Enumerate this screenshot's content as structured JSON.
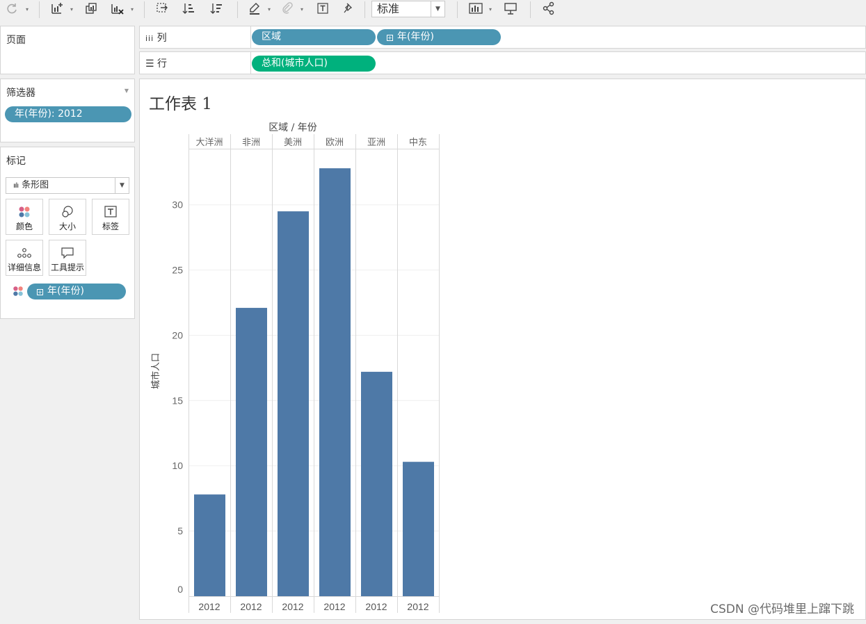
{
  "toolbar": {
    "icons": [
      "refresh-icon",
      "new-worksheet-icon",
      "duplicate-sheet-icon",
      "clear-sheet-icon",
      "swap-icon",
      "sort-ascending-icon",
      "sort-descending-icon",
      "highlight-icon",
      "paperclip-icon",
      "text-label-icon",
      "pin-icon",
      "show-me-icon",
      "presentation-icon",
      "share-icon"
    ],
    "fit_select": "标准"
  },
  "pages_panel": {
    "title": "页面"
  },
  "columns_shelf": {
    "label": "列",
    "pills": [
      {
        "text": "区域",
        "expandable": false
      },
      {
        "text": "年(年份)",
        "expandable": true
      }
    ]
  },
  "rows_shelf": {
    "label": "行",
    "pills": [
      {
        "text": "总和(城市人口)"
      }
    ]
  },
  "filters_panel": {
    "title": "筛选器",
    "pills": [
      {
        "text": "年(年份): 2012"
      }
    ]
  },
  "marks_panel": {
    "title": "标记",
    "mark_type": "条形图",
    "cards": [
      {
        "label": "颜色",
        "icon": "color-icon"
      },
      {
        "label": "大小",
        "icon": "size-icon"
      },
      {
        "label": "标签",
        "icon": "label-icon"
      },
      {
        "label": "详细信息",
        "icon": "detail-icon"
      },
      {
        "label": "工具提示",
        "icon": "tooltip-icon"
      }
    ],
    "field_pill": {
      "text": "年(年份)",
      "expandable": true
    }
  },
  "sheet": {
    "title": "工作表 1"
  },
  "watermark": "CSDN @代码堆里上蹿下跳",
  "colors": {
    "bar": "#4e79a7",
    "pill_blue": "#4b96b3",
    "pill_green": "#00b17d"
  },
  "chart_data": {
    "type": "bar",
    "header": "区域 / 年份",
    "ylabel": "城市人口",
    "ylim": [
      0,
      34.3
    ],
    "yticks": [
      0,
      5,
      10,
      15,
      20,
      25,
      30
    ],
    "categories": [
      "大洋洲",
      "非洲",
      "美洲",
      "欧洲",
      "亚洲",
      "中东"
    ],
    "sub_label": "2012",
    "values": [
      7.8,
      22.1,
      29.5,
      32.8,
      17.2,
      10.3
    ]
  }
}
